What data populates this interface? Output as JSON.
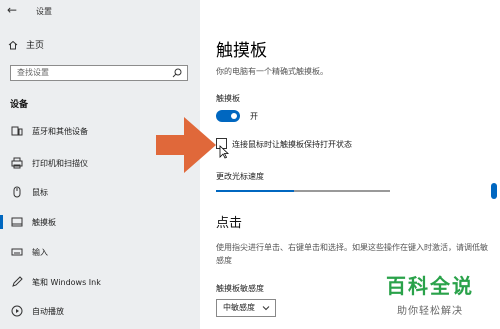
{
  "window": {
    "back_glyph": "←",
    "title": "设置"
  },
  "sidebar": {
    "home_label": "主页",
    "search_placeholder": "查找设置",
    "section_title": "设备",
    "items": [
      {
        "label": "蓝牙和其他设备",
        "icon": "bluetooth-icon"
      },
      {
        "label": "打印机和扫描仪",
        "icon": "printer-icon"
      },
      {
        "label": "鼠标",
        "icon": "mouse-icon"
      },
      {
        "label": "触摸板",
        "icon": "touchpad-icon",
        "active": true
      },
      {
        "label": "输入",
        "icon": "keyboard-icon"
      },
      {
        "label": "笔和 Windows Ink",
        "icon": "pen-icon"
      },
      {
        "label": "自动播放",
        "icon": "autoplay-icon"
      }
    ]
  },
  "main": {
    "title": "触摸板",
    "subtitle": "你的电脑有一个精确式触摸板。",
    "toggle_label": "触摸板",
    "toggle_state": "开",
    "checkbox_label": "连接鼠标时让触摸板保持打开状态",
    "checkbox_checked": false,
    "cursor_speed_label": "更改光标速度",
    "cursor_speed_fraction": 0.45,
    "section_title": "点击",
    "section_desc": "使用指尖进行单击、右键单击和选择。如果这些操作在键入时激活，请调低敏感度",
    "sensitivity_label": "触摸板敏感度",
    "sensitivity_value": "中敏感度"
  },
  "watermark": {
    "main": "百科全说",
    "sub": "助你轻松解决"
  },
  "colors": {
    "accent": "#0067c0",
    "arrow": "#e0683a",
    "watermark": "#2aa24a"
  }
}
